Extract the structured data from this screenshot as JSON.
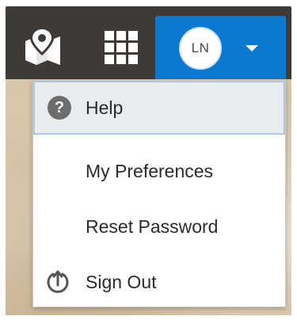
{
  "header": {
    "icons": [
      "map-pin-icon",
      "apps-grid-icon",
      "chevron-down-icon"
    ],
    "user": {
      "initials": "LN"
    },
    "colors": {
      "bar": "#3f3a36",
      "accent": "#0b79d0"
    }
  },
  "menu": {
    "items": [
      {
        "label": "Help",
        "icon": "help-icon",
        "active": true
      },
      {
        "label": "My Preferences"
      },
      {
        "label": "Reset Password"
      },
      {
        "label": "Sign Out",
        "icon": "sign-out-icon"
      }
    ]
  }
}
